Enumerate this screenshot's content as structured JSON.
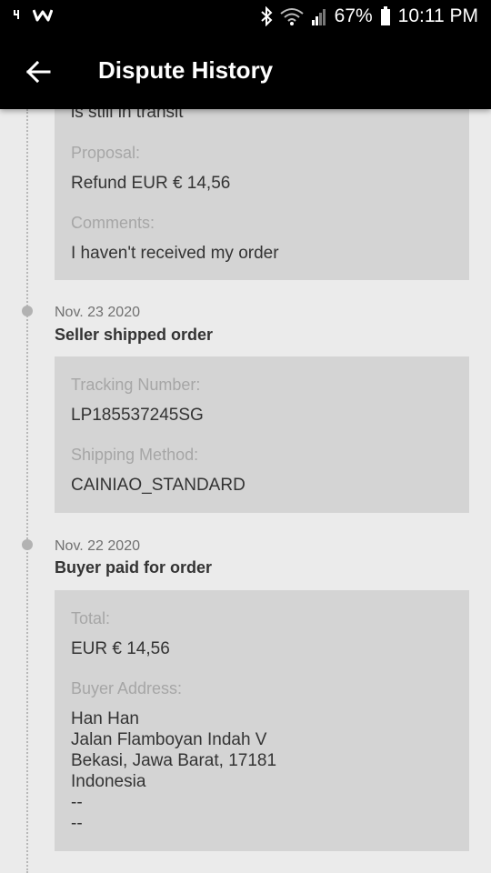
{
  "status_bar": {
    "battery": "67%",
    "time": "10:11 PM",
    "icons": [
      "notification-icon",
      "w-logo-icon",
      "bluetooth-icon",
      "wifi-icon",
      "signal-icon",
      "battery-icon"
    ]
  },
  "app_bar": {
    "title": "Dispute History",
    "back_icon": "arrow-left-icon"
  },
  "events": [
    {
      "card": {
        "partial_text": "is still in transit",
        "fields": [
          {
            "label": "Proposal:",
            "value": "Refund EUR € 14,56"
          },
          {
            "label": "Comments:",
            "value": "I haven't received my order"
          }
        ]
      }
    },
    {
      "date": "Nov. 23 2020",
      "title": "Seller shipped order",
      "card": {
        "fields": [
          {
            "label": "Tracking Number:",
            "value": "LP185537245SG"
          },
          {
            "label": "Shipping Method:",
            "value": "CAINIAO_STANDARD"
          }
        ]
      }
    },
    {
      "date": "Nov. 22 2020",
      "title": "Buyer paid for order",
      "card": {
        "fields": [
          {
            "label": "Total:",
            "value": "EUR € 14,56"
          },
          {
            "label": "Buyer Address:",
            "value": "Han Han\nJalan Flamboyan Indah V\nBekasi, Jawa Barat, 17181\nIndonesia\n--\n--"
          }
        ]
      }
    }
  ],
  "colors": {
    "background": "#ebebeb",
    "app_bar": "#000000",
    "card": "#d4d4d4",
    "label": "#a6a6a6",
    "value": "#333333",
    "timeline_dot": "#b2b2b2"
  }
}
